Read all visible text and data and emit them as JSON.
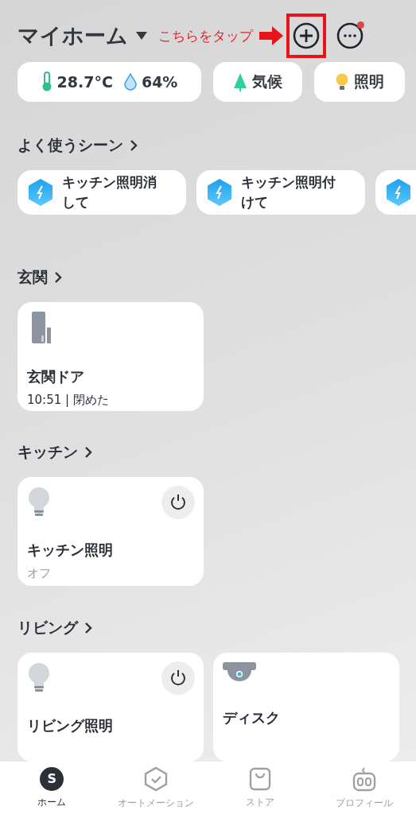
{
  "header": {
    "title": "マイホーム",
    "annotation": "こちらをタップ",
    "more_badge": true
  },
  "chips": [
    {
      "kind": "weather",
      "temperature": "28.7°C",
      "humidity": "64%"
    },
    {
      "kind": "climate",
      "label": "気候"
    },
    {
      "kind": "lighting",
      "label": "照明"
    }
  ],
  "scenes": {
    "title": "よく使うシーン",
    "items": [
      {
        "kind": "scene",
        "name": "キッチン照明消して"
      },
      {
        "kind": "scene",
        "name": "キッチン照明付けて"
      },
      {
        "kind": "scene"
      }
    ]
  },
  "rooms": [
    {
      "title": "玄関",
      "devices": [
        {
          "kind": "sensor",
          "name": "玄関ドア",
          "status": "10:51 | 閉めた"
        }
      ]
    },
    {
      "title": "キッチン",
      "devices": [
        {
          "kind": "light",
          "name": "キッチン照明",
          "status": "オフ",
          "on": false
        }
      ]
    },
    {
      "title": "リビング",
      "devices": [
        {
          "kind": "light",
          "name": "リビング照明",
          "on": false
        },
        {
          "kind": "camera",
          "name": "ディスク"
        }
      ]
    }
  ],
  "tabs": [
    {
      "kind": "home",
      "label": "ホーム",
      "avatar": "S",
      "selected": true
    },
    {
      "kind": "automation",
      "label": "オートメーション",
      "selected": false
    },
    {
      "kind": "store",
      "label": "ストア",
      "selected": false
    },
    {
      "kind": "profile",
      "label": "プロフィール",
      "selected": false
    }
  ]
}
